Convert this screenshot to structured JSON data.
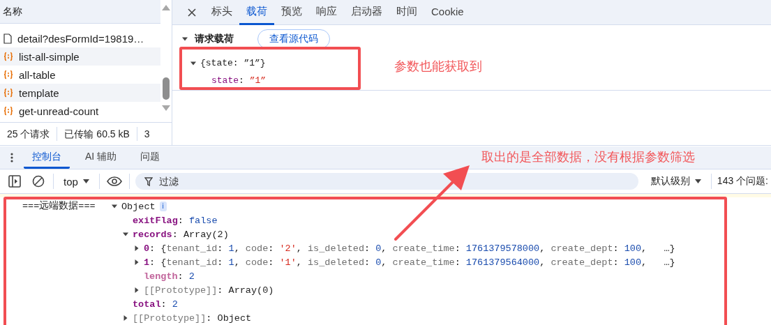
{
  "request_list": {
    "header": "名称",
    "items": [
      {
        "name": "detail?desFormId=19819…",
        "kind": "document"
      },
      {
        "name": "list-all-simple",
        "kind": "fetch"
      },
      {
        "name": "all-table",
        "kind": "fetch"
      },
      {
        "name": "template",
        "kind": "fetch"
      },
      {
        "name": "get-unread-count",
        "kind": "fetch"
      }
    ],
    "status": [
      "25 个请求",
      "已传输 60.5 kB",
      "3"
    ]
  },
  "detail_tabs": [
    {
      "label": "标头",
      "selected": false
    },
    {
      "label": "载荷",
      "selected": true
    },
    {
      "label": "预览",
      "selected": false
    },
    {
      "label": "响应",
      "selected": false
    },
    {
      "label": "启动器",
      "selected": false
    },
    {
      "label": "时间",
      "selected": false
    },
    {
      "label": "Cookie",
      "selected": false
    }
  ],
  "payload": {
    "section": "请求载荷",
    "expanded": true,
    "view_source_button": "查看源代码",
    "tree": {
      "expanded": true,
      "segments": [
        {
          "text": "{state: ”1”}",
          "kind": "plain"
        }
      ],
      "children": [
        {
          "segments": [
            {
              "text": "state",
              "kind": "pkey"
            },
            {
              "text": ": ",
              "kind": "plain"
            },
            {
              "text": "”1”",
              "kind": "string"
            }
          ]
        }
      ]
    }
  },
  "drawer_tabs": [
    {
      "label": "控制台",
      "selected": true
    },
    {
      "label": "AI 辅助",
      "selected": false
    },
    {
      "label": "问题",
      "selected": false
    }
  ],
  "console_toolbar": {
    "context": "top",
    "filter_placeholder": "过滤",
    "level": "默认级别",
    "issues": "143 个问题:"
  },
  "console_message": {
    "label": "===远端数据===",
    "tree": {
      "expanded": true,
      "badge": "i",
      "segments": [
        {
          "text": "Object",
          "kind": "plain"
        }
      ],
      "children": [
        {
          "segments": [
            {
              "text": "exitFlag",
              "kind": "key"
            },
            {
              "text": ": ",
              "kind": "plain"
            },
            {
              "text": "false",
              "kind": "number"
            }
          ]
        },
        {
          "expanded": true,
          "segments": [
            {
              "text": "records",
              "kind": "key"
            },
            {
              "text": ": Array(2)",
              "kind": "plain"
            }
          ],
          "children": [
            {
              "expanded": false,
              "segments": [
                {
                  "text": "0",
                  "kind": "key"
                },
                {
                  "text": ": {",
                  "kind": "plain"
                },
                {
                  "text": "tenant_id",
                  "kind": "prop"
                },
                {
                  "text": ": ",
                  "kind": "plain"
                },
                {
                  "text": "1",
                  "kind": "number"
                },
                {
                  "text": ", ",
                  "kind": "plain"
                },
                {
                  "text": "code",
                  "kind": "prop"
                },
                {
                  "text": ": ",
                  "kind": "plain"
                },
                {
                  "text": "'2'",
                  "kind": "string"
                },
                {
                  "text": ", ",
                  "kind": "plain"
                },
                {
                  "text": "is_deleted",
                  "kind": "prop"
                },
                {
                  "text": ": ",
                  "kind": "plain"
                },
                {
                  "text": "0",
                  "kind": "number"
                },
                {
                  "text": ", ",
                  "kind": "plain"
                },
                {
                  "text": "create_time",
                  "kind": "prop"
                },
                {
                  "text": ": ",
                  "kind": "plain"
                },
                {
                  "text": "1761379578000",
                  "kind": "number"
                },
                {
                  "text": ", ",
                  "kind": "plain"
                },
                {
                  "text": "create_dept",
                  "kind": "prop"
                },
                {
                  "text": ": ",
                  "kind": "plain"
                },
                {
                  "text": "100",
                  "kind": "number"
                },
                {
                  "text": ",   …}",
                  "kind": "plain"
                }
              ]
            },
            {
              "expanded": false,
              "segments": [
                {
                  "text": "1",
                  "kind": "key"
                },
                {
                  "text": ": {",
                  "kind": "plain"
                },
                {
                  "text": "tenant_id",
                  "kind": "prop"
                },
                {
                  "text": ": ",
                  "kind": "plain"
                },
                {
                  "text": "1",
                  "kind": "number"
                },
                {
                  "text": ", ",
                  "kind": "plain"
                },
                {
                  "text": "code",
                  "kind": "prop"
                },
                {
                  "text": ": ",
                  "kind": "plain"
                },
                {
                  "text": "'1'",
                  "kind": "string"
                },
                {
                  "text": ", ",
                  "kind": "plain"
                },
                {
                  "text": "is_deleted",
                  "kind": "prop"
                },
                {
                  "text": ": ",
                  "kind": "plain"
                },
                {
                  "text": "0",
                  "kind": "number"
                },
                {
                  "text": ", ",
                  "kind": "plain"
                },
                {
                  "text": "create_time",
                  "kind": "prop"
                },
                {
                  "text": ": ",
                  "kind": "plain"
                },
                {
                  "text": "1761379564000",
                  "kind": "number"
                },
                {
                  "text": ", ",
                  "kind": "plain"
                },
                {
                  "text": "create_dept",
                  "kind": "prop"
                },
                {
                  "text": ": ",
                  "kind": "plain"
                },
                {
                  "text": "100",
                  "kind": "number"
                },
                {
                  "text": ",   …}",
                  "kind": "plain"
                }
              ]
            },
            {
              "segments": [
                {
                  "text": "length",
                  "kind": "key_dim"
                },
                {
                  "text": ": ",
                  "kind": "plain"
                },
                {
                  "text": "2",
                  "kind": "number"
                }
              ]
            },
            {
              "expanded": false,
              "segments": [
                {
                  "text": "[[Prototype]]",
                  "kind": "proto"
                },
                {
                  "text": ": Array(0)",
                  "kind": "plain"
                }
              ]
            }
          ]
        },
        {
          "segments": [
            {
              "text": "total",
              "kind": "key"
            },
            {
              "text": ": ",
              "kind": "plain"
            },
            {
              "text": "2",
              "kind": "number"
            }
          ]
        },
        {
          "expanded": false,
          "segments": [
            {
              "text": "[[Prototype]]",
              "kind": "proto"
            },
            {
              "text": ": Object",
              "kind": "plain"
            }
          ]
        }
      ]
    }
  },
  "annotations": [
    {
      "text": "参数也能获取到"
    },
    {
      "text": "取出的是全部数据，没有根据参数筛选"
    }
  ]
}
